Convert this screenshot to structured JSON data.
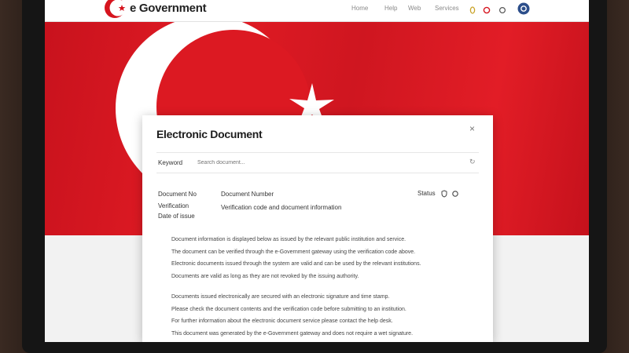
{
  "header": {
    "logo_text": "e Government",
    "nav": [
      "Home",
      "Help",
      "Web",
      "Services"
    ],
    "icons": [
      "bell-icon",
      "globe-icon",
      "power-icon",
      "user-icon"
    ]
  },
  "modal": {
    "title": "Electronic Document",
    "close_glyph": "×",
    "search": {
      "label": "Keyword",
      "placeholder": "Search document...",
      "refresh_glyph": "↻"
    },
    "rows": [
      {
        "label": "Document No",
        "value": "Document Number"
      },
      {
        "label": "Verification",
        "value": "Verification code and document information"
      },
      {
        "label": "Date of issue",
        "value": ""
      }
    ],
    "meta": {
      "text": "Status"
    },
    "paragraphs": [
      [
        "Document information is displayed below as issued by the relevant public institution and service.",
        "The document can be verified through the e-Government gateway using the verification code above.",
        "Electronic documents issued through the system are valid and can be used by the relevant institutions.",
        "Documents are valid as long as they are not revoked by the issuing authority."
      ],
      [
        "Documents issued electronically are secured with an electronic signature and time stamp.",
        "Please check the document contents and the verification code before submitting to an institution.",
        "For further information about the electronic document service please contact the help desk.",
        "This document was generated by the e-Government gateway and does not require a wet signature."
      ]
    ]
  }
}
